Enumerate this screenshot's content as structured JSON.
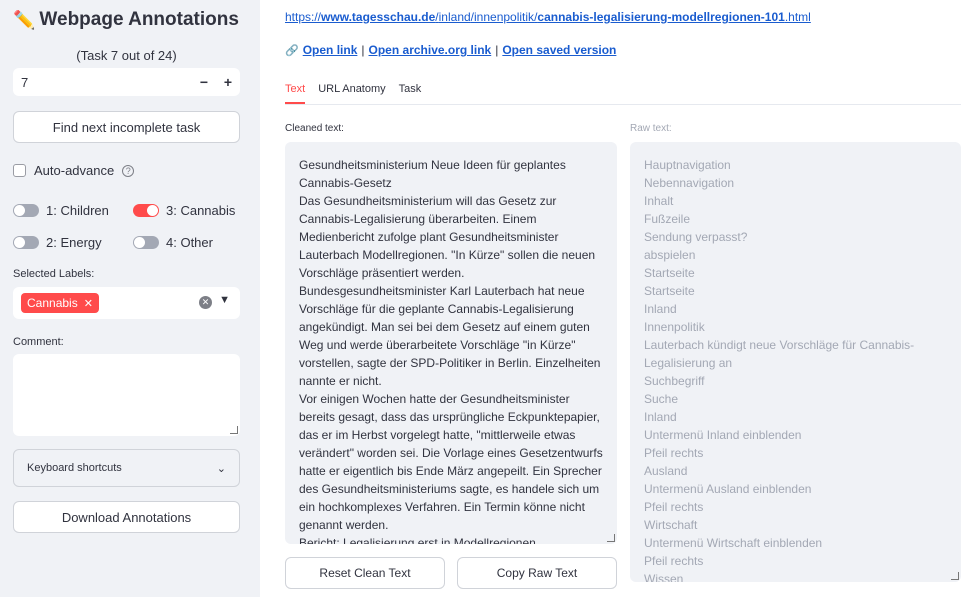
{
  "sidebar": {
    "title": "Webpage Annotations",
    "task_counter": "(Task 7 out of 24)",
    "task_number": "7",
    "minus_label": "−",
    "plus_label": "+",
    "find_next_label": "Find next incomplete task",
    "auto_advance_label": "Auto-advance",
    "help_glyph": "?",
    "toggles": [
      {
        "label": "1: Children",
        "on": false
      },
      {
        "label": "3: Cannabis",
        "on": true
      },
      {
        "label": "2: Energy",
        "on": false
      },
      {
        "label": "4: Other",
        "on": false
      }
    ],
    "selected_labels_title": "Selected Labels:",
    "selected_chip": "Cannabis",
    "comment_title": "Comment:",
    "keyboard_shortcuts_label": "Keyboard shortcuts",
    "download_label": "Download Annotations"
  },
  "main": {
    "url": {
      "prefix": "https://",
      "domain": "www.tagesschau.de",
      "sep1": "/",
      "path1": "inland",
      "sep2": "/",
      "path2": "innenpolitik",
      "sep3": "/",
      "slug": "cannabis-legalisierung-modellregionen-101",
      "ext": ".html"
    },
    "links": {
      "open_link": "Open link",
      "sep": "|",
      "archive": "Open archive.org link",
      "saved": "Open saved version"
    },
    "tabs": [
      "Text",
      "URL Anatomy",
      "Task"
    ],
    "cleaned_label": "Cleaned text:",
    "raw_label": "Raw text:",
    "cleaned_lines": [
      "Gesundheitsministerium Neue Ideen für geplantes",
      "Cannabis-Gesetz",
      "Das Gesundheitsministerium will das Gesetz zur",
      "Cannabis-Legalisierung überarbeiten. Einem",
      "Medienbericht zufolge plant Gesundheitsminister",
      "Lauterbach Modellregionen. \"In Kürze\" sollen die neuen",
      "Vorschläge präsentiert werden.",
      "Bundesgesundheitsminister Karl Lauterbach hat neue",
      "Vorschläge für die geplante Cannabis-Legalisierung",
      "angekündigt. Man sei bei dem Gesetz auf einem guten",
      "Weg und werde überarbeitete Vorschläge \"in Kürze\"",
      "vorstellen, sagte der SPD-Politiker in Berlin. Einzelheiten",
      "nannte er nicht.",
      "Vor einigen Wochen hatte der Gesundheitsminister",
      "bereits gesagt, dass das ursprüngliche Eckpunktepapier,",
      "das er im Herbst vorgelegt hatte, \"mittlerweile etwas",
      "verändert\" worden sei. Die Vorlage eines Gesetzentwurfs",
      "hatte er eigentlich bis Ende März angepeilt. Ein Sprecher",
      "des Gesundheitsministeriums sagte, es handele sich um",
      "ein hochkomplexes Verfahren. Ein Termin könne nicht",
      "genannt werden.",
      "Bericht: Legalisierung erst in Modellregionen"
    ],
    "raw_lines": [
      "Hauptnavigation",
      "Nebennavigation",
      "Inhalt",
      "Fußzeile",
      "Sendung verpasst?",
      "abspielen",
      "Startseite",
      "Startseite",
      "Inland",
      "Innenpolitik",
      "Lauterbach kündigt neue Vorschläge für Cannabis-",
      "Legalisierung an",
      "Suchbegriff",
      "Suche",
      "Inland",
      "Untermenü Inland einblenden",
      "Pfeil rechts",
      "Ausland",
      "Untermenü Ausland einblenden",
      "Pfeil rechts",
      "Wirtschaft",
      "Untermenü Wirtschaft einblenden",
      "Pfeil rechts",
      "Wissen"
    ],
    "reset_label": "Reset Clean Text",
    "copy_label": "Copy Raw Text"
  }
}
